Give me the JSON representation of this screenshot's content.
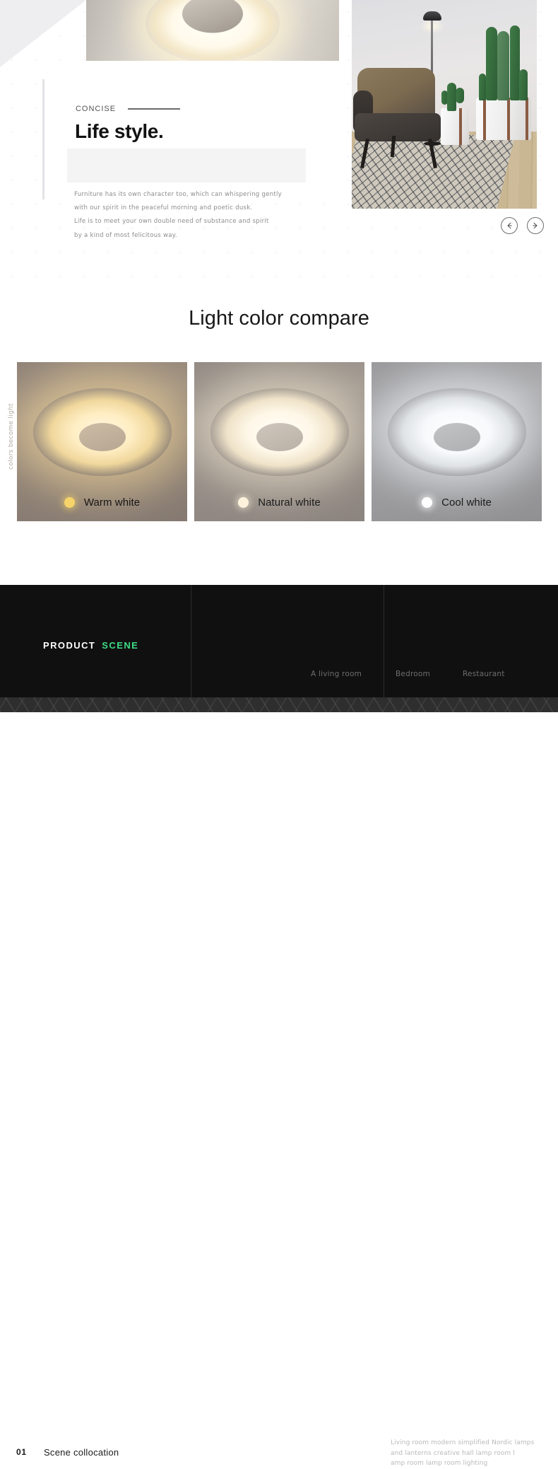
{
  "hero": {
    "kicker": "CONCISE",
    "headline": "Life style.",
    "body_lines": [
      "Furniture has its own character too, which can whispering gently",
      "with our spirit in the peaceful morning and poetic dusk.",
      "Life is to meet your own double need of substance and spirit",
      "by a kind of most felicitous way."
    ],
    "carousel": {
      "prev_label": "←",
      "next_label": "→"
    },
    "images": {
      "top_lamp_alt": "ring-ceiling-lamp-glowing",
      "room_alt": "living-room-armchair-floor-lamp-cactus"
    }
  },
  "compare": {
    "title": "Light color compare",
    "vertical_label": "colors become light",
    "cards": [
      {
        "label": "Warm white",
        "dot_color": "#f6d46a",
        "name": "warm-white"
      },
      {
        "label": "Natural white",
        "dot_color": "#fdf3dc",
        "name": "natural-white"
      },
      {
        "label": "Cool white",
        "dot_color": "#ffffff",
        "name": "cool-white"
      }
    ]
  },
  "scene": {
    "brand_primary": "PRODUCT",
    "brand_accent": "SCENE",
    "accent_color": "#3ddc84",
    "tabs": [
      {
        "label": "A living room"
      },
      {
        "label": "Bedroom"
      },
      {
        "label": "Restaurant"
      }
    ]
  },
  "footer": {
    "number": "01",
    "title": "Scene  collocation",
    "desc_lines": [
      "Living room modern simplified Nordic lamps",
      "and lanterns creative hall lamp room l",
      "amp room lamp room lighting"
    ]
  }
}
